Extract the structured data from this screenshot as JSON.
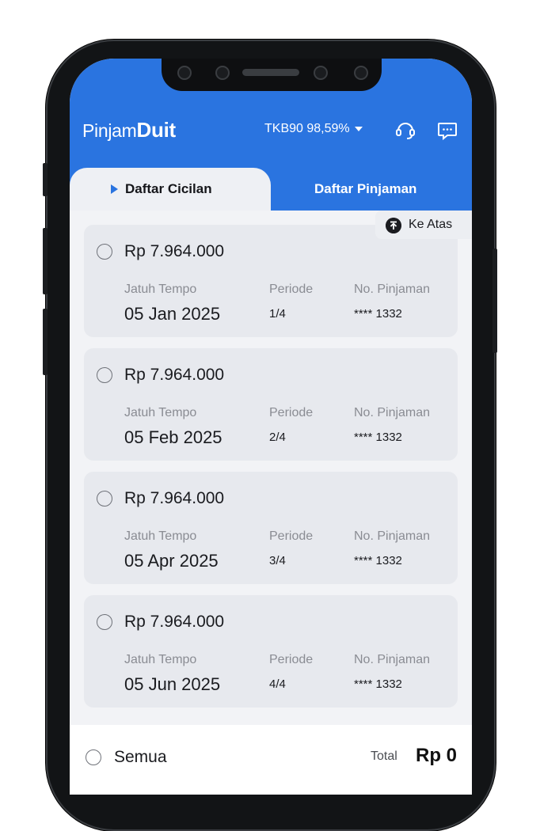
{
  "header": {
    "logo_light": "Pinjam",
    "logo_bold": "Duit",
    "account": "TKB90 98,59%",
    "headset_icon": "headset-icon",
    "chat_icon": "chat-icon"
  },
  "tabs": [
    {
      "label": "Daftar Cicilan",
      "active": true
    },
    {
      "label": "Daftar Pinjaman",
      "active": false
    }
  ],
  "to_top_label": "Ke Atas",
  "installments": [
    {
      "amount": "Rp 7.964.000",
      "due_label": "Jatuh Tempo",
      "due": "05 Jan 2025",
      "period_label": "Periode",
      "period": "1/4",
      "loan_label": "No. Pinjaman",
      "loan": "**** 1332"
    },
    {
      "amount": "Rp 7.964.000",
      "due_label": "Jatuh Tempo",
      "due": "05 Feb 2025",
      "period_label": "Periode",
      "period": "2/4",
      "loan_label": "No. Pinjaman",
      "loan": "**** 1332"
    },
    {
      "amount": "Rp 7.964.000",
      "due_label": "Jatuh Tempo",
      "due": "05 Apr 2025",
      "period_label": "Periode",
      "period": "3/4",
      "loan_label": "No. Pinjaman",
      "loan": "**** 1332"
    },
    {
      "amount": "Rp 7.964.000",
      "due_label": "Jatuh Tempo",
      "due": "05 Jun 2025",
      "period_label": "Periode",
      "period": "4/4",
      "loan_label": "No. Pinjaman",
      "loan": "**** 1332"
    }
  ],
  "footer": {
    "select_all": "Semua",
    "total_label": "Total",
    "total_value": "Rp 0"
  },
  "colors": {
    "primary": "#2a74e0",
    "card": "#e7e9ee",
    "background": "#f2f3f6"
  }
}
